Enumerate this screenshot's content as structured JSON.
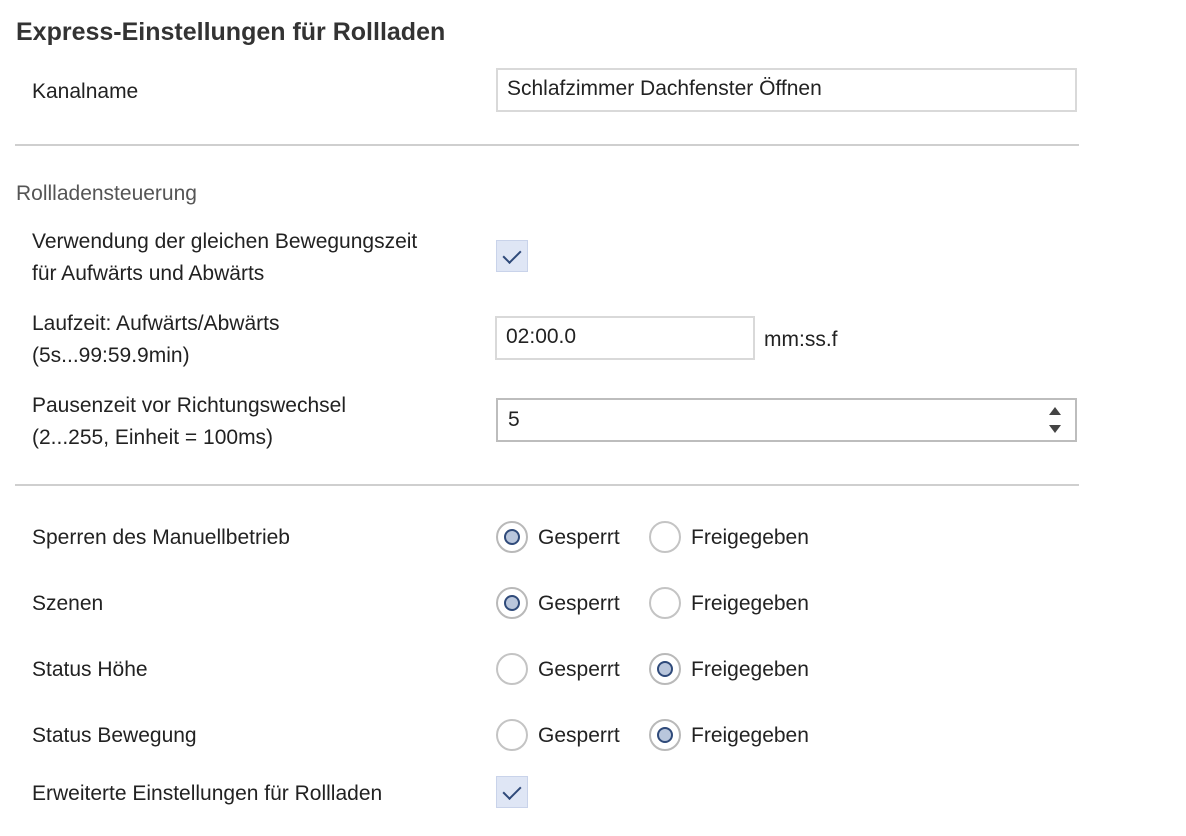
{
  "title": "Express-Einstellungen für Rollladen",
  "channel": {
    "label": "Kanalname",
    "value": "Schlafzimmer Dachfenster Öffnen"
  },
  "section": {
    "title": "Rollladensteuerung"
  },
  "same_time": {
    "label_line1": "Verwendung der gleichen Bewegungszeit",
    "label_line2": "für Aufwärts und Abwärts",
    "checked": true
  },
  "runtime": {
    "label_line1": "Laufzeit: Aufwärts/Abwärts",
    "label_line2": "(5s...99:59.9min)",
    "value": "02:00.0",
    "unit": "mm:ss.f"
  },
  "pause": {
    "label_line1": "Pausenzeit vor Richtungswechsel",
    "label_line2": "(2...255, Einheit = 100ms)",
    "value": "5"
  },
  "options": {
    "locked_label": "Gesperrt",
    "released_label": "Freigegeben"
  },
  "manual": {
    "label": "Sperren des Manuellbetrieb",
    "selected": "Gesperrt"
  },
  "scenes": {
    "label": "Szenen",
    "selected": "Gesperrt"
  },
  "status_height": {
    "label": "Status Höhe",
    "selected": "Freigegeben"
  },
  "status_motion": {
    "label": "Status Bewegung",
    "selected": "Freigegeben"
  },
  "advanced": {
    "label": "Erweiterte Einstellungen für Rollladen",
    "checked": true
  },
  "colors": {
    "accent": "#2f4a7a",
    "checkbox_fill": "#dfe6f5",
    "divider": "#cfcfcf"
  }
}
